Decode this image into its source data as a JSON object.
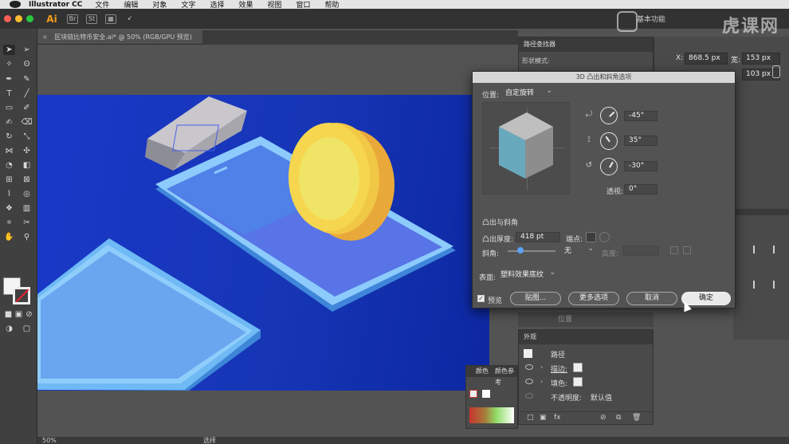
{
  "menubar": {
    "app_name": "Illustrator CC",
    "items": [
      "文件",
      "编辑",
      "对象",
      "文字",
      "选择",
      "效果",
      "视图",
      "窗口",
      "帮助"
    ]
  },
  "appbar": {
    "app_icon_text": "Ai",
    "icon_text_br": "Br",
    "icon_text_st": "St",
    "workspace_label": "基本功能"
  },
  "watermark": "虎课网",
  "document": {
    "tab_title": "区块链比特币安全.ai* @ 50% (RGB/GPU 预览)",
    "close": "×"
  },
  "statusbar": {
    "zoom": "50%",
    "tool_name": "选择"
  },
  "pathfinder": {
    "title": "路径查找器",
    "mode_label": "形状模式:"
  },
  "transform": {
    "x_label": "X:",
    "x_value": "868.5 px",
    "w_label": "宽:",
    "w_value": "153 px",
    "h_value": "103 px"
  },
  "dialog": {
    "title": "3D 凸出和斜角选项",
    "position_label": "位置:",
    "position_value": "自定旋转",
    "rot_x": "-45°",
    "rot_y": "35°",
    "rot_z": "-30°",
    "perspective_label": "透视:",
    "perspective_value": "0°",
    "extrude_section": "凸出与斜角",
    "extrude_depth_label": "凸出厚度:",
    "extrude_depth_value": "418 pt",
    "cap_label": "端点:",
    "bevel_label": "斜角:",
    "bevel_value": "无",
    "height_label": "高度:",
    "surface_label": "表面:",
    "surface_value": "塑料效果底纹",
    "preview_label": "预览",
    "btn_map": "贴图...",
    "btn_more": "更多选项",
    "btn_cancel": "取消",
    "btn_ok": "确定"
  },
  "position_panel_label": "位置",
  "appearance": {
    "title": "外观",
    "path_label": "路径",
    "stroke_label": "描边:",
    "fill_label": "填色:",
    "opacity_label": "不透明度:",
    "opacity_value": "默认值"
  },
  "colorpanel": {
    "tab_color": "颜色",
    "tab_guide": "颜色参考"
  },
  "colors": {
    "artboard_blue": "#1a38c8",
    "phone_frame": "#6fb9f5",
    "coin_yellow": "#f1dc55",
    "coin_edge": "#e9a93a",
    "silver": "#c9c7cc",
    "cube_front": "#69a9bd",
    "cube_top": "#bfbfbf",
    "cube_side": "#8d8d8d"
  }
}
